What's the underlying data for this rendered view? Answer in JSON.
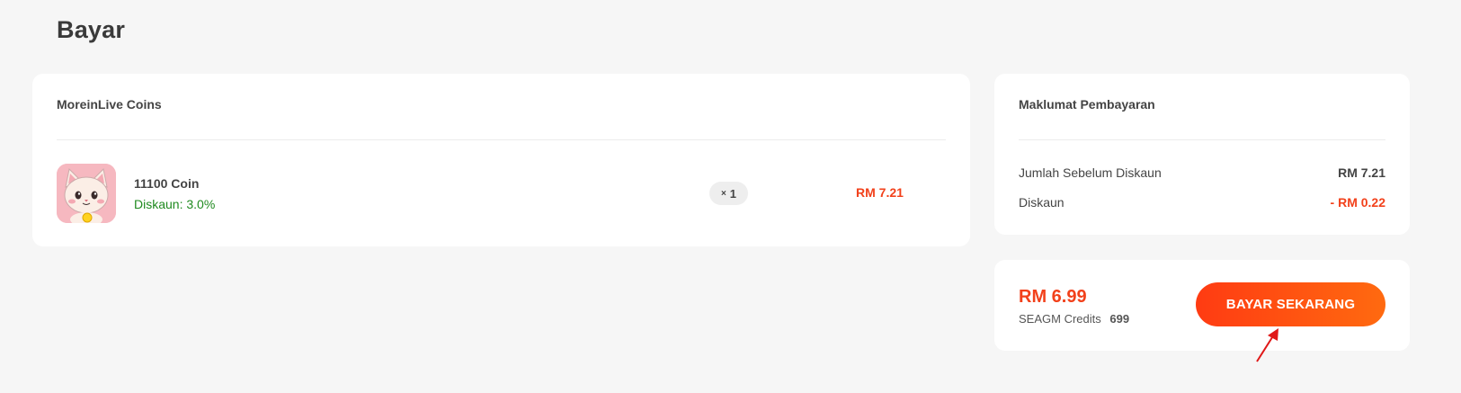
{
  "page": {
    "title": "Bayar"
  },
  "product_card": {
    "title": "MoreinLive Coins",
    "item": {
      "image_icon": "cat-coin-icon",
      "name": "11100 Coin",
      "discount": "Diskaun: 3.0%",
      "quantity_prefix": "×",
      "quantity": "1",
      "price": "RM 7.21"
    }
  },
  "payment_info": {
    "title": "Maklumat Pembayaran",
    "rows": [
      {
        "label": "Jumlah Sebelum Diskaun",
        "value": "RM 7.21"
      },
      {
        "label": "Diskaun",
        "value": "- RM 0.22"
      }
    ]
  },
  "payment_summary": {
    "total": "RM 6.99",
    "credits_label": "SEAGM Credits",
    "credits_value": "699",
    "pay_button_label": "BAYAR SEKARANG"
  },
  "colors": {
    "accent": "#f2411b",
    "discount_green": "#1f8a1f",
    "background": "#f6f6f6"
  }
}
